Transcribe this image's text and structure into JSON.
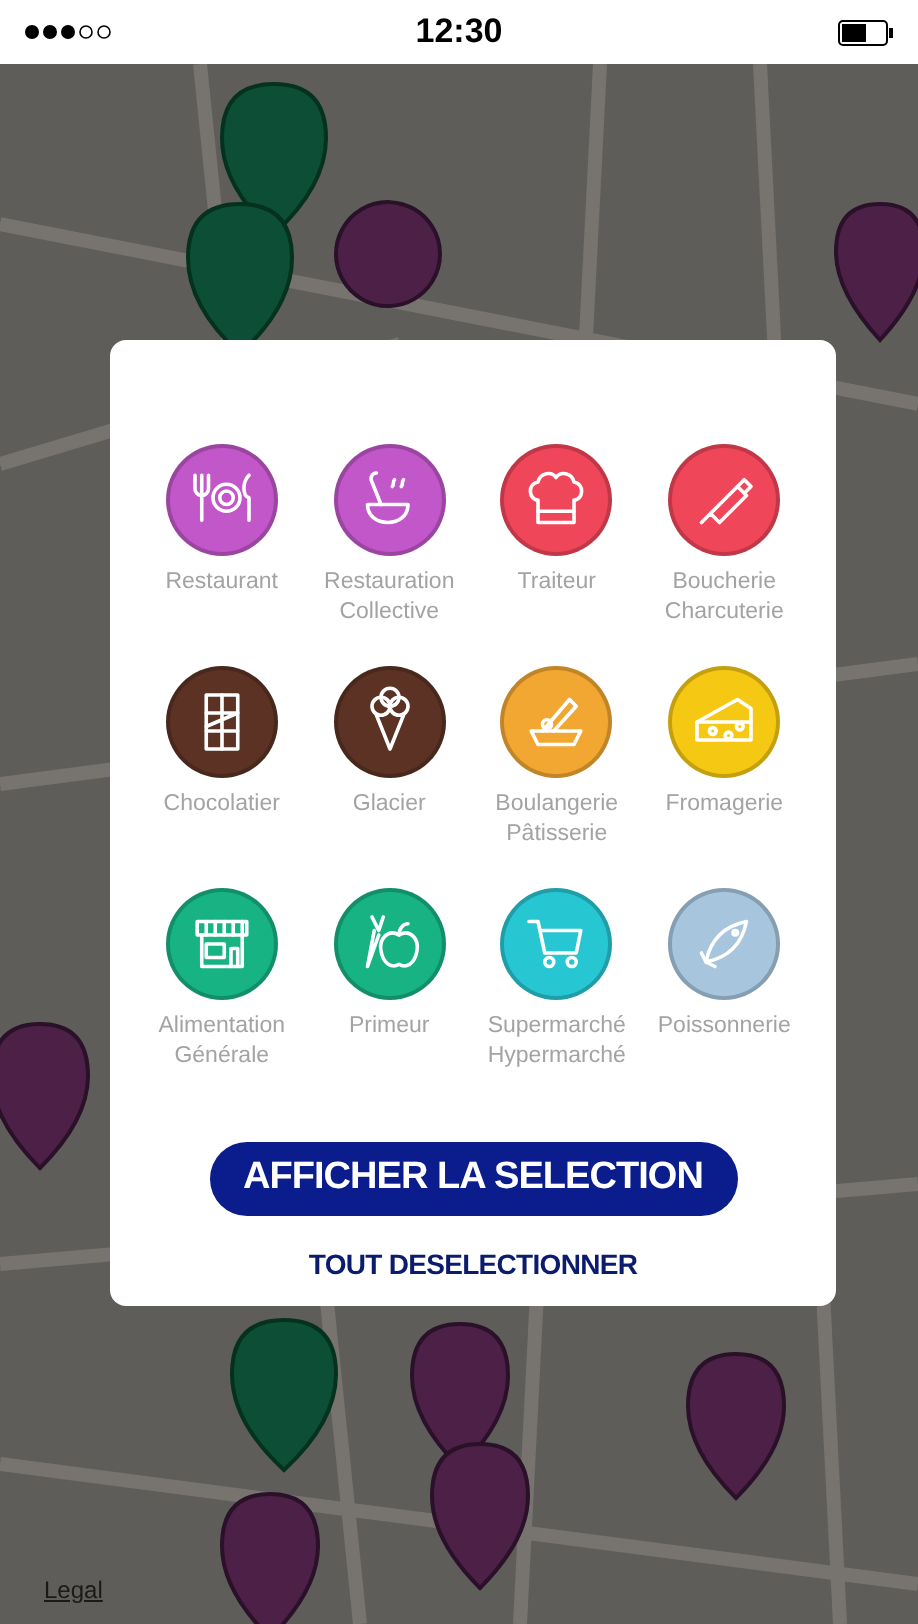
{
  "status_bar": {
    "time": "12:30"
  },
  "categories": [
    {
      "label": "Restaurant",
      "color": "#c157c9"
    },
    {
      "label": "Restauration Collective",
      "color": "#c157c9"
    },
    {
      "label": "Traiteur",
      "color": "#f0465a"
    },
    {
      "label": "Boucherie Charcuterie",
      "color": "#f0465a"
    },
    {
      "label": "Chocolatier",
      "color": "#5b3224"
    },
    {
      "label": "Glacier",
      "color": "#5b3224"
    },
    {
      "label": "Boulangerie Pâtisserie",
      "color": "#f2a732"
    },
    {
      "label": "Fromagerie",
      "color": "#f5c913"
    },
    {
      "label": "Alimentation Générale",
      "color": "#17b383"
    },
    {
      "label": "Primeur",
      "color": "#17b383"
    },
    {
      "label": "Supermarché Hypermarché",
      "color": "#27c6d3"
    },
    {
      "label": "Poissonnerie",
      "color": "#a7c6de"
    }
  ],
  "primary_button": "AFFICHER LA SELECTION",
  "secondary_button": "TOUT DESELECTIONNER",
  "map": {
    "legal_link": "Legal"
  }
}
